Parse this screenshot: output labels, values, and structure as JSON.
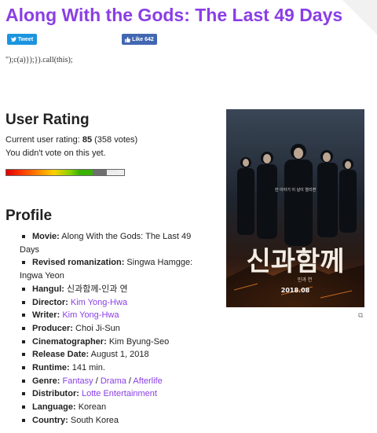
{
  "page": {
    "title": "Along With the Gods: The Last 49 Days",
    "code_leak": "\");c(a)});}).call(this);"
  },
  "social": {
    "tweet_label": "Tweet",
    "like_label": "Like 642"
  },
  "rating": {
    "heading": "User Rating",
    "current_prefix": "Current user rating: ",
    "score": "85",
    "votes": " (358 votes)",
    "vote_status": "You didn't vote on this yet.",
    "bar_percent": "85%",
    "bar_value": 0.85
  },
  "profile": {
    "heading": "Profile",
    "items": [
      {
        "label": "Movie:",
        "value": "Along With the Gods: The Last 49 Days"
      },
      {
        "label": "Revised romanization:",
        "value": "Singwa Hamgge: Ingwa Yeon"
      },
      {
        "label": "Hangul:",
        "value": "신과함께-인과 연"
      },
      {
        "label": "Director:",
        "value": "Kim Yong-Hwa"
      },
      {
        "label": "Writer:",
        "value": "Kim Yong-Hwa"
      },
      {
        "label": "Producer:",
        "value": "Choi Ji-Sun"
      },
      {
        "label": "Cinematographer:",
        "value": "Kim Byung-Seo"
      },
      {
        "label": "Release Date:",
        "value": "August 1, 2018"
      },
      {
        "label": "Runtime:",
        "value": "141 min."
      },
      {
        "label": "Genre:",
        "genres": [
          "Fantasy",
          "Drama",
          "Afterlife"
        ],
        "separator": " / "
      },
      {
        "label": "Distributor:",
        "value": "Lotte Entertainment"
      },
      {
        "label": "Language:",
        "value": "Korean"
      },
      {
        "label": "Country:",
        "value": "South Korea"
      }
    ]
  },
  "poster": {
    "tagline": "한 이야기 이 날이 열리면",
    "title_art": "신과함께",
    "subtitle_art": "인과 연",
    "date": "2018.08"
  },
  "colors": {
    "accent": "#8a3ee6",
    "tweet": "#1b95e0",
    "facebook": "#4267b2"
  }
}
